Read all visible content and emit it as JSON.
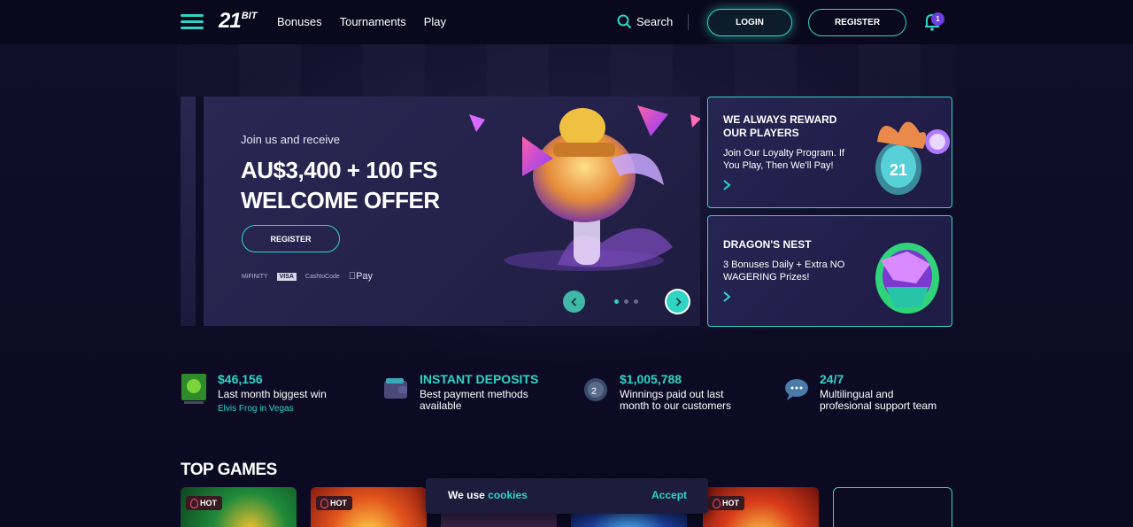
{
  "header": {
    "logo_main": "21",
    "logo_sub": "BIT",
    "nav": [
      {
        "label": "Bonuses"
      },
      {
        "label": "Tournaments"
      },
      {
        "label": "Play"
      }
    ],
    "search_label": "Search",
    "login_label": "LOGIN",
    "register_label": "REGISTER",
    "notification_count": "1"
  },
  "hero": {
    "intro": "Join us and receive",
    "title_line1": "AU$3,400 + 100 FS",
    "title_line2": "WELCOME OFFER",
    "register_label": "REGISTER",
    "payments": [
      "MiFINITY",
      "VISA",
      "CashtoCode",
      "Pay"
    ],
    "carousel_dots": 3,
    "active_dot": 0
  },
  "promos": [
    {
      "title": "WE ALWAYS REWARD OUR PLAYERS",
      "desc": "Join Our Loyalty Program. If You Play, Then We'll Pay!"
    },
    {
      "title": "DRAGON'S NEST",
      "desc": "3 Bonuses Daily + Extra NO WAGERING Prizes!"
    }
  ],
  "stats": [
    {
      "value": "$46,156",
      "label": "Last month biggest win",
      "sub": "Elvis Frog in Vegas",
      "icon": "game-thumb-icon"
    },
    {
      "value": "INSTANT DEPOSITS",
      "label": "Best payment methods available",
      "icon": "wallet-icon"
    },
    {
      "value": "$1,005,788",
      "label": "Winnings paid out last month to our customers",
      "icon": "coin-icon"
    },
    {
      "value": "24/7",
      "label": "Multilingual and profesional support team",
      "icon": "chat-bubble-icon"
    }
  ],
  "top_games": {
    "title": "TOP GAMES",
    "cards": [
      {
        "badge": "HOT"
      },
      {
        "badge": "HOT"
      },
      {
        "badge": ""
      },
      {
        "badge": ""
      },
      {
        "badge": "HOT"
      },
      {
        "badge": ""
      }
    ]
  },
  "cookie": {
    "text": "We use",
    "link": "cookies",
    "accept": "Accept"
  },
  "colors": {
    "accent": "#2fd4c4",
    "background": "#0d0b24",
    "card": "#262452",
    "badge_purple": "#6d3fe0"
  }
}
